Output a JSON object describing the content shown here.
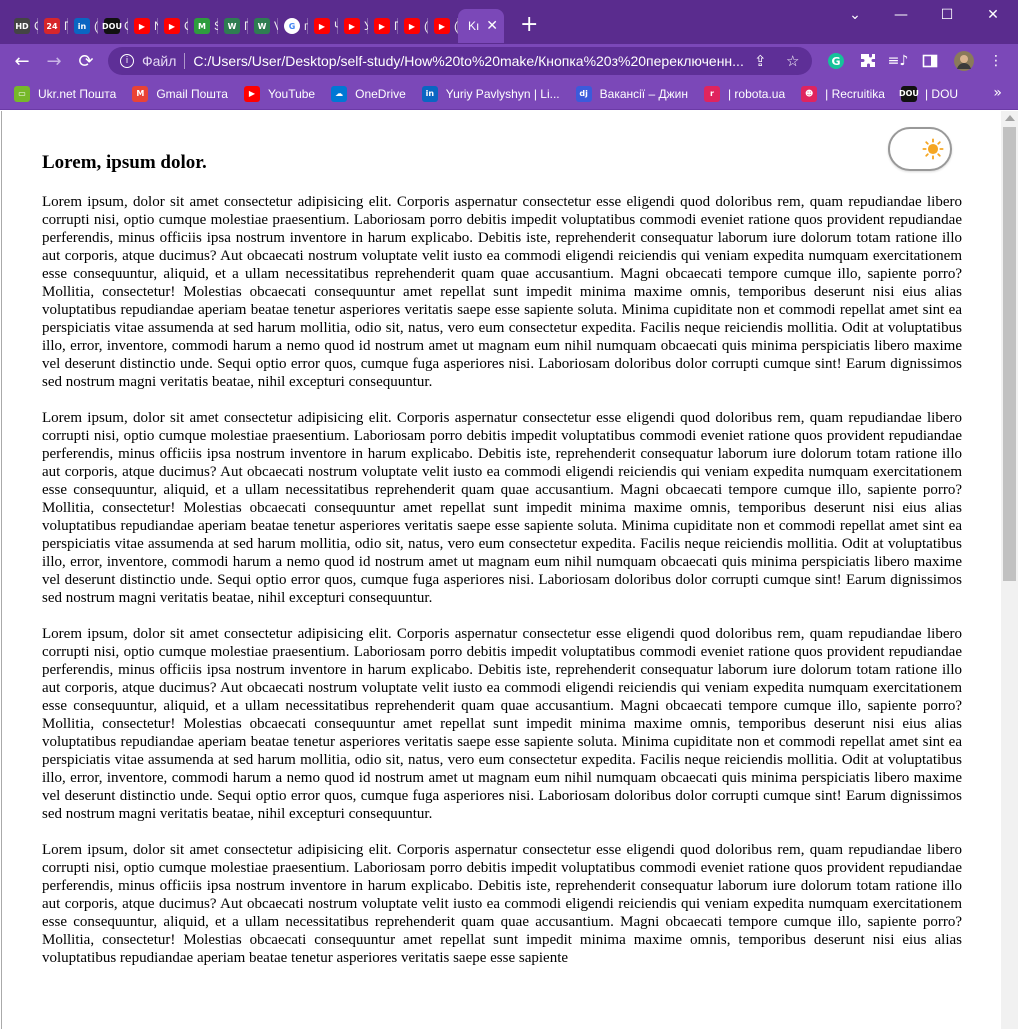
{
  "browser": {
    "tabs": [
      {
        "icon": "hd-icon",
        "letter": "C",
        "color": "#444444",
        "glyph": "HD"
      },
      {
        "icon": "24-icon",
        "letter": "П",
        "color": "#d7262b",
        "glyph": "24"
      },
      {
        "icon": "linkedin-icon",
        "letter": "(",
        "color": "#0a66c2",
        "glyph": "in"
      },
      {
        "icon": "dou-icon",
        "letter": "C",
        "color": "#111111",
        "glyph": "DOU"
      },
      {
        "icon": "youtube-icon",
        "letter": "N",
        "color": "#ff0000",
        "glyph": "▶"
      },
      {
        "icon": "youtube-icon",
        "letter": "C",
        "color": "#ff0000",
        "glyph": "▶"
      },
      {
        "icon": "m-icon",
        "letter": "S",
        "color": "#2e9c3e",
        "glyph": "M"
      },
      {
        "icon": "w-icon",
        "letter": "П",
        "color": "#2e7d52",
        "glyph": "W"
      },
      {
        "icon": "w-icon",
        "letter": "V",
        "color": "#2e7d52",
        "glyph": "W"
      },
      {
        "icon": "google-icon",
        "letter": "п",
        "color": "#ffffff",
        "glyph": "G"
      },
      {
        "icon": "youtube-icon",
        "letter": "Ч",
        "color": "#ff0000",
        "glyph": "▶"
      },
      {
        "icon": "youtube-icon",
        "letter": "У",
        "color": "#ff0000",
        "glyph": "▶"
      },
      {
        "icon": "youtube-icon",
        "letter": "П",
        "color": "#ff0000",
        "glyph": "▶"
      },
      {
        "icon": "youtube-icon",
        "letter": "(",
        "color": "#ff0000",
        "glyph": "▶"
      },
      {
        "icon": "youtube-icon",
        "letter": "(",
        "color": "#ff0000",
        "glyph": "▶"
      }
    ],
    "active_tab": {
      "letter": "Kı",
      "close": "✕"
    },
    "new_tab": "+",
    "window_controls": {
      "minimize": "—",
      "maximize": "☐",
      "close": "✕",
      "dropdown": "⌄"
    },
    "address": {
      "scheme_label": "Файл",
      "url": "C:/Users/User/Desktop/self-study/How%20to%20make/Кнопка%20з%20переключенн..."
    },
    "bookmarks": [
      {
        "label": "Ukr.net Пошта",
        "icon": "ukrnet-icon",
        "color": "#76b82a",
        "glyph": "▭"
      },
      {
        "label": "Gmail Пошта",
        "icon": "gmail-icon",
        "color": "#ea4335",
        "glyph": "M"
      },
      {
        "label": "YouTube",
        "icon": "youtube-icon",
        "color": "#ff0000",
        "glyph": "▶"
      },
      {
        "label": "OneDrive",
        "icon": "onedrive-icon",
        "color": "#0078d4",
        "glyph": "☁"
      },
      {
        "label": "Yuriy Pavlyshyn | Li...",
        "icon": "linkedin-icon",
        "color": "#0a66c2",
        "glyph": "in"
      },
      {
        "label": "Вакансії – Джин",
        "icon": "djinni-icon",
        "color": "#3b5bdb",
        "glyph": "dj"
      },
      {
        "label": "| robota.ua",
        "icon": "robota-icon",
        "color": "#e0245e",
        "glyph": "r"
      },
      {
        "label": "| Recruitika",
        "icon": "recruitika-icon",
        "color": "#e0245e",
        "glyph": "☻"
      },
      {
        "label": "| DOU",
        "icon": "dou-icon",
        "color": "#111111",
        "glyph": "DOU"
      }
    ],
    "bookmarks_more": "»"
  },
  "page": {
    "heading": "Lorem, ipsum dolor.",
    "paragraphs": [
      "Lorem ipsum, dolor sit amet consectetur adipisicing elit. Corporis aspernatur consectetur esse eligendi quod doloribus rem, quam repudiandae libero corrupti nisi, optio cumque molestiae praesentium. Laboriosam porro debitis impedit voluptatibus commodi eveniet ratione quos provident repudiandae perferendis, minus officiis ipsa nostrum inventore in harum explicabo. Debitis iste, reprehenderit consequatur laborum iure dolorum totam ratione illo aut corporis, atque ducimus? Aut obcaecati nostrum voluptate velit iusto ea commodi eligendi reiciendis qui veniam expedita numquam exercitationem esse consequuntur, aliquid, et a ullam necessitatibus reprehenderit quam quae accusantium. Magni obcaecati tempore cumque illo, sapiente porro? Mollitia, consectetur! Molestias obcaecati consequuntur amet repellat sunt impedit minima maxime omnis, temporibus deserunt nisi eius alias voluptatibus repudiandae aperiam beatae tenetur asperiores veritatis saepe esse sapiente soluta. Minima cupiditate non et commodi repellat amet sint ea perspiciatis vitae assumenda at sed harum mollitia, odio sit, natus, vero eum consectetur expedita. Facilis neque reiciendis mollitia. Odit at voluptatibus illo, error, inventore, commodi harum a nemo quod id nostrum amet ut magnam eum nihil numquam obcaecati quis minima perspiciatis libero maxime vel deserunt distinctio unde. Sequi optio error quos, cumque fuga asperiores nisi. Laboriosam doloribus dolor corrupti cumque sint! Earum dignissimos sed nostrum magni veritatis beatae, nihil excepturi consequuntur.",
      "Lorem ipsum, dolor sit amet consectetur adipisicing elit. Corporis aspernatur consectetur esse eligendi quod doloribus rem, quam repudiandae libero corrupti nisi, optio cumque molestiae praesentium. Laboriosam porro debitis impedit voluptatibus commodi eveniet ratione quos provident repudiandae perferendis, minus officiis ipsa nostrum inventore in harum explicabo. Debitis iste, reprehenderit consequatur laborum iure dolorum totam ratione illo aut corporis, atque ducimus? Aut obcaecati nostrum voluptate velit iusto ea commodi eligendi reiciendis qui veniam expedita numquam exercitationem esse consequuntur, aliquid, et a ullam necessitatibus reprehenderit quam quae accusantium. Magni obcaecati tempore cumque illo, sapiente porro? Mollitia, consectetur! Molestias obcaecati consequuntur amet repellat sunt impedit minima maxime omnis, temporibus deserunt nisi eius alias voluptatibus repudiandae aperiam beatae tenetur asperiores veritatis saepe esse sapiente soluta. Minima cupiditate non et commodi repellat amet sint ea perspiciatis vitae assumenda at sed harum mollitia, odio sit, natus, vero eum consectetur expedita. Facilis neque reiciendis mollitia. Odit at voluptatibus illo, error, inventore, commodi harum a nemo quod id nostrum amet ut magnam eum nihil numquam obcaecati quis minima perspiciatis libero maxime vel deserunt distinctio unde. Sequi optio error quos, cumque fuga asperiores nisi. Laboriosam doloribus dolor corrupti cumque sint! Earum dignissimos sed nostrum magni veritatis beatae, nihil excepturi consequuntur.",
      "Lorem ipsum, dolor sit amet consectetur adipisicing elit. Corporis aspernatur consectetur esse eligendi quod doloribus rem, quam repudiandae libero corrupti nisi, optio cumque molestiae praesentium. Laboriosam porro debitis impedit voluptatibus commodi eveniet ratione quos provident repudiandae perferendis, minus officiis ipsa nostrum inventore in harum explicabo. Debitis iste, reprehenderit consequatur laborum iure dolorum totam ratione illo aut corporis, atque ducimus? Aut obcaecati nostrum voluptate velit iusto ea commodi eligendi reiciendis qui veniam expedita numquam exercitationem esse consequuntur, aliquid, et a ullam necessitatibus reprehenderit quam quae accusantium. Magni obcaecati tempore cumque illo, sapiente porro? Mollitia, consectetur! Molestias obcaecati consequuntur amet repellat sunt impedit minima maxime omnis, temporibus deserunt nisi eius alias voluptatibus repudiandae aperiam beatae tenetur asperiores veritatis saepe esse sapiente soluta. Minima cupiditate non et commodi repellat amet sint ea perspiciatis vitae assumenda at sed harum mollitia, odio sit, natus, vero eum consectetur expedita. Facilis neque reiciendis mollitia. Odit at voluptatibus illo, error, inventore, commodi harum a nemo quod id nostrum amet ut magnam eum nihil numquam obcaecati quis minima perspiciatis libero maxime vel deserunt distinctio unde. Sequi optio error quos, cumque fuga asperiores nisi. Laboriosam doloribus dolor corrupti cumque sint! Earum dignissimos sed nostrum magni veritatis beatae, nihil excepturi consequuntur.",
      "Lorem ipsum, dolor sit amet consectetur adipisicing elit. Corporis aspernatur consectetur esse eligendi quod doloribus rem, quam repudiandae libero corrupti nisi, optio cumque molestiae praesentium. Laboriosam porro debitis impedit voluptatibus commodi eveniet ratione quos provident repudiandae perferendis, minus officiis ipsa nostrum inventore in harum explicabo. Debitis iste, reprehenderit consequatur laborum iure dolorum totam ratione illo aut corporis, atque ducimus? Aut obcaecati nostrum voluptate velit iusto ea commodi eligendi reiciendis qui veniam expedita numquam exercitationem esse consequuntur, aliquid, et a ullam necessitatibus reprehenderit quam quae accusantium. Magni obcaecati tempore cumque illo, sapiente porro? Mollitia, consectetur! Molestias obcaecati consequuntur amet repellat sunt impedit minima maxime omnis, temporibus deserunt nisi eius alias voluptatibus repudiandae aperiam beatae tenetur asperiores veritatis saepe esse sapiente"
    ],
    "theme_toggle": {
      "state": "light",
      "icon": "sun-icon",
      "accent": "#f5a623"
    }
  },
  "colors": {
    "tabstrip": "#5a2c8e",
    "toolbar": "#7b48b8"
  }
}
